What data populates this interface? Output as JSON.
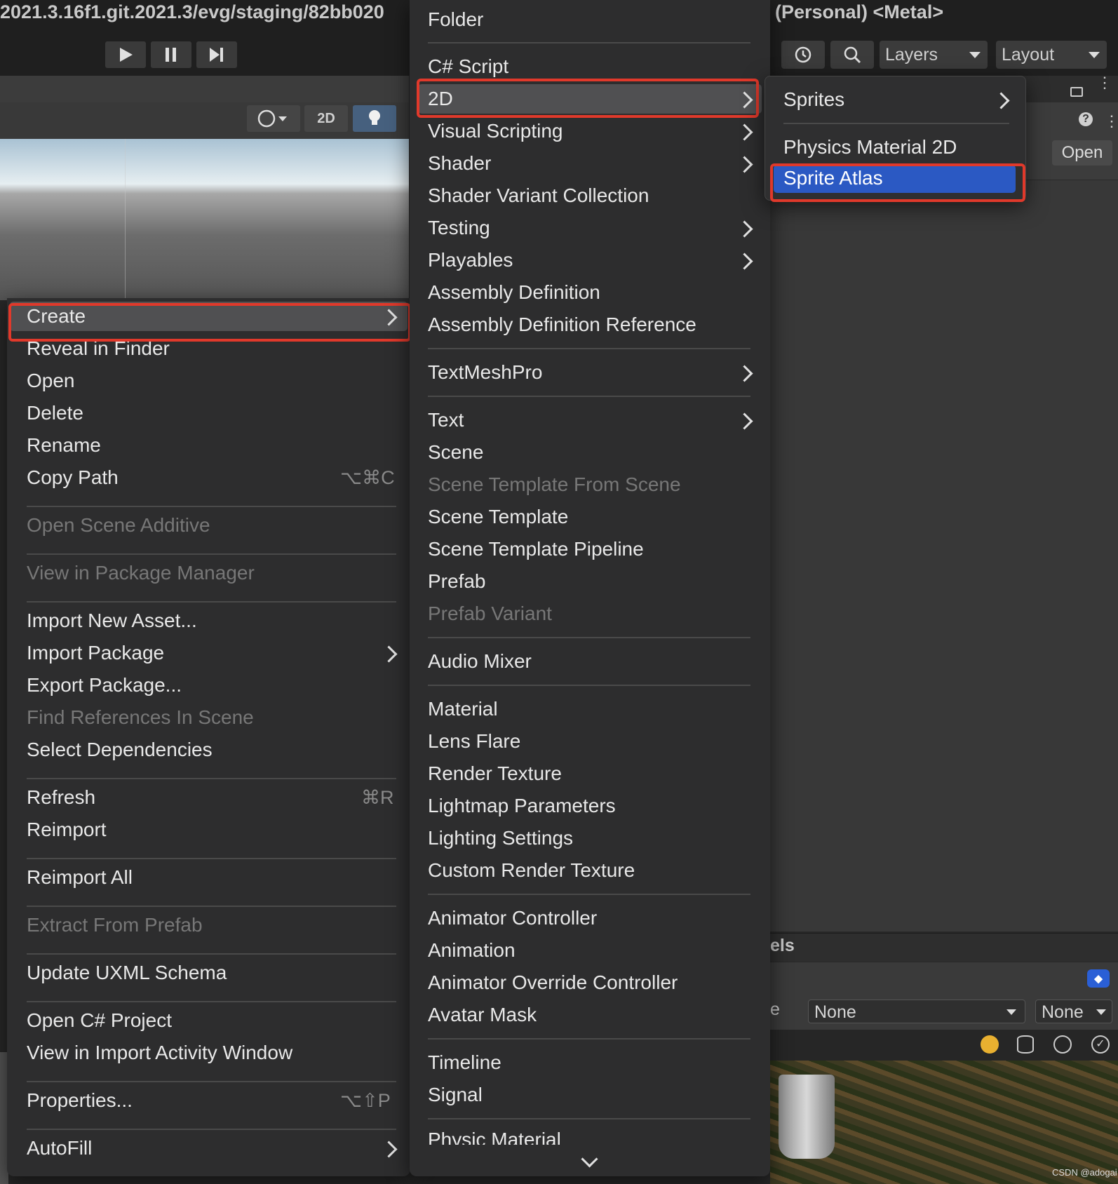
{
  "titlebar": {
    "left_text": "2021.3.16f1.git.2021.3/evg/staging/82bb020",
    "right_text": "(Personal) <Metal>"
  },
  "toolbar": {
    "play_icon": "play-icon",
    "pause_icon": "pause-icon",
    "step_icon": "step-icon",
    "layers_label": "Layers",
    "layout_label": "Layout",
    "history_icon": "history-icon",
    "search_icon": "search-icon"
  },
  "scene_toolbar": {
    "mode_2d": "2D",
    "shading_icon": "shading-sphere-icon",
    "light_icon": "lightbulb-icon"
  },
  "right_panel": {
    "open_label": "Open",
    "labels_title": "els",
    "field_prefix": "e",
    "dropdown1_value": "None",
    "dropdown2_value": "None"
  },
  "watermark": "CSDN @adogai",
  "left_menu": {
    "items": [
      {
        "label": "Create",
        "submenu": true,
        "highlighted": true
      },
      {
        "label": "Reveal in Finder"
      },
      {
        "label": "Open"
      },
      {
        "label": "Delete"
      },
      {
        "label": "Rename"
      },
      {
        "label": "Copy Path",
        "shortcut": "⌥⌘C"
      },
      {
        "label": "Open Scene Additive",
        "disabled": true
      },
      {
        "label": "View in Package Manager",
        "disabled": true
      },
      {
        "label": "Import New Asset..."
      },
      {
        "label": "Import Package",
        "submenu": true
      },
      {
        "label": "Export Package..."
      },
      {
        "label": "Find References In Scene",
        "disabled": true
      },
      {
        "label": "Select Dependencies"
      },
      {
        "label": "Refresh",
        "shortcut": "⌘R"
      },
      {
        "label": "Reimport"
      },
      {
        "label": "Reimport All"
      },
      {
        "label": "Extract From Prefab",
        "disabled": true
      },
      {
        "label": "Update UXML Schema"
      },
      {
        "label": "Open C# Project"
      },
      {
        "label": "View in Import Activity Window"
      },
      {
        "label": "Properties...",
        "shortcut": "⌥⇧P"
      },
      {
        "label": "AutoFill",
        "submenu": true
      }
    ]
  },
  "create_menu": {
    "items": [
      {
        "label": "Folder"
      },
      {
        "label": "C# Script"
      },
      {
        "label": "2D",
        "submenu": true,
        "highlighted": true
      },
      {
        "label": "Visual Scripting",
        "submenu": true
      },
      {
        "label": "Shader",
        "submenu": true
      },
      {
        "label": "Shader Variant Collection"
      },
      {
        "label": "Testing",
        "submenu": true
      },
      {
        "label": "Playables",
        "submenu": true
      },
      {
        "label": "Assembly Definition"
      },
      {
        "label": "Assembly Definition Reference"
      },
      {
        "label": "TextMeshPro",
        "submenu": true
      },
      {
        "label": "Text",
        "submenu": true
      },
      {
        "label": "Scene"
      },
      {
        "label": "Scene Template From Scene",
        "disabled": true
      },
      {
        "label": "Scene Template"
      },
      {
        "label": "Scene Template Pipeline"
      },
      {
        "label": "Prefab"
      },
      {
        "label": "Prefab Variant",
        "disabled": true
      },
      {
        "label": "Audio Mixer"
      },
      {
        "label": "Material"
      },
      {
        "label": "Lens Flare"
      },
      {
        "label": "Render Texture"
      },
      {
        "label": "Lightmap Parameters"
      },
      {
        "label": "Lighting Settings"
      },
      {
        "label": "Custom Render Texture"
      },
      {
        "label": "Animator Controller"
      },
      {
        "label": "Animation"
      },
      {
        "label": "Animator Override Controller"
      },
      {
        "label": "Avatar Mask"
      },
      {
        "label": "Timeline"
      },
      {
        "label": "Signal"
      },
      {
        "label": "Physic Material"
      }
    ],
    "scroll_icon": "chevron-down-icon"
  },
  "submenu_2d": {
    "items": [
      {
        "label": "Sprites",
        "submenu": true
      },
      {
        "label": "Physics Material 2D"
      },
      {
        "label": "Sprite Atlas",
        "selected": true
      }
    ]
  },
  "colors": {
    "selection_blue": "#2b59c3",
    "annotation_red": "#e0392b",
    "hover_gray": "#505052"
  }
}
